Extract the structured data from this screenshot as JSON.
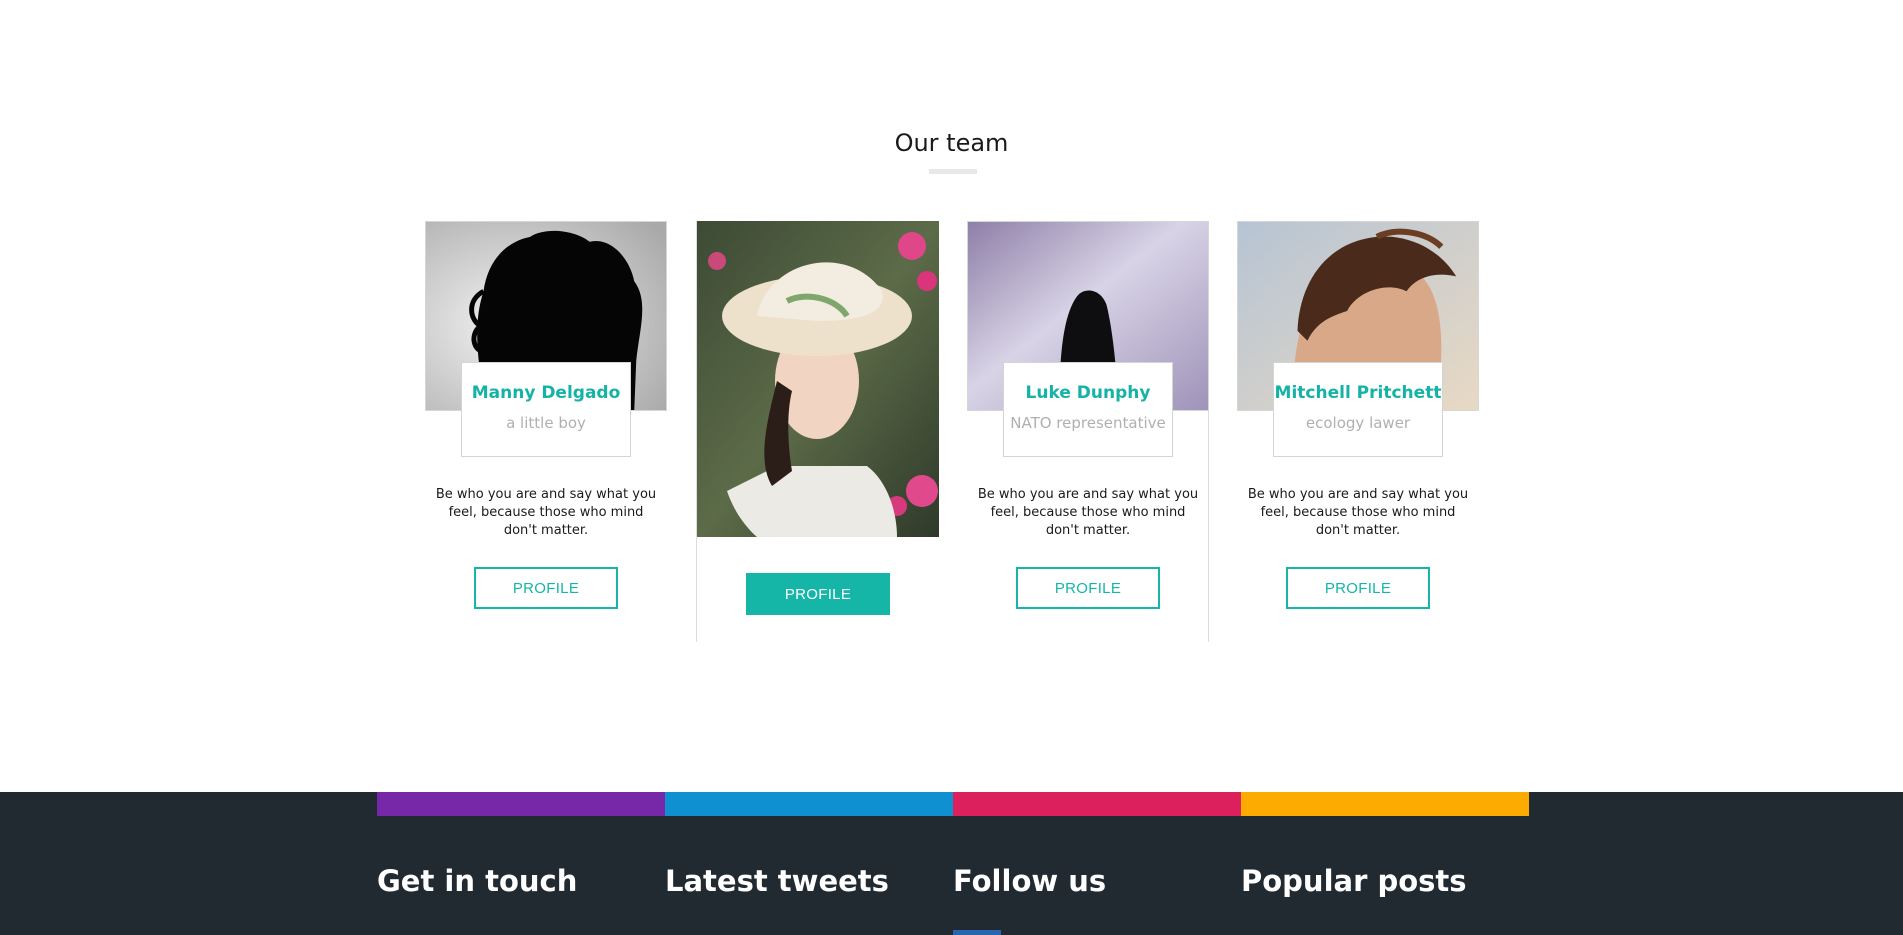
{
  "team": {
    "title": "Our team",
    "members": [
      {
        "name": "Manny Delgado",
        "role": "a little boy",
        "description": "Be who you are and say what you feel, because those who mind don't matter.",
        "button_label": "PROFILE"
      },
      {
        "name": "",
        "role": "",
        "description": "",
        "button_label": "PROFILE"
      },
      {
        "name": "Luke Dunphy",
        "role": "NATO representative",
        "description": "Be who you are and say what you feel, because those who mind don't matter.",
        "button_label": "PROFILE"
      },
      {
        "name": "Mitchell Pritchett",
        "role": "ecology lawer",
        "description": "Be who you are and say what you feel, because those who mind don't matter.",
        "button_label": "PROFILE"
      }
    ]
  },
  "footer": {
    "color_bar": [
      "#7628a8",
      "#0f91d1",
      "#dc1f5d",
      "#fdab00"
    ],
    "headings": [
      "Get in touch",
      "Latest tweets",
      "Follow us",
      "Popular posts"
    ],
    "background": "#212931"
  },
  "theme": {
    "accent": "#15b5a8"
  }
}
